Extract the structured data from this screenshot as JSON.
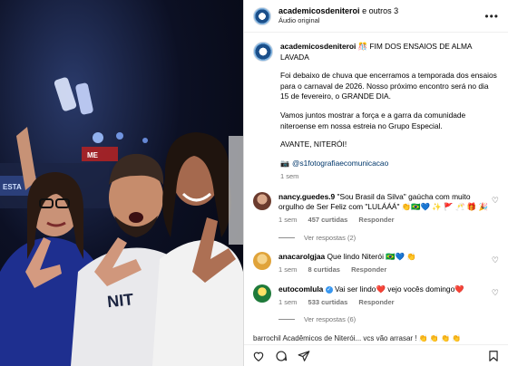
{
  "header": {
    "account": "academicosdeniteroi",
    "and_others": "e outros 3",
    "audio": "Áudio original",
    "more_glyph": "•••"
  },
  "caption": {
    "username": "academicosdeniteroi",
    "emoji": "🎊",
    "headline": "FIM DOS ENSAIOS DE ALMA LAVADA",
    "paragraph1": "Foi debaixo de chuva que encerramos a temporada dos ensaios para o carnaval de 2026. Nosso próximo encontro será no dia 15 de fevereiro, o GRANDE DIA.",
    "paragraph2": "Vamos juntos mostrar a força e a garra da comunidade niteroense em nossa estreia no Grupo Especial.",
    "paragraph3": "AVANTE, NITERÓI!",
    "credit": "@s1fotografiaecomunicacao",
    "time": "1 sem"
  },
  "comments": [
    {
      "username": "nancy.guedes.9",
      "text": "\"Sou Brasil da Silva\" gaúcha com muito orgulho de Ser Feliz com \"LULÁÁÁ\" 👏🇧🇷💙 ✨ 🚩 🥂 🎁 🎉",
      "time": "1 sem",
      "likes": "457 curtidas",
      "reply_label": "Responder",
      "replies": "Ver respostas (2)",
      "avatar_color": "#6b3b2e"
    },
    {
      "username": "anacarolgjaa",
      "text": "Que lindo Niterói 🇧🇷💙 👏",
      "time": "1 sem",
      "likes": "8 curtidas",
      "reply_label": "Responder",
      "replies": "",
      "avatar_color": "#e0a33a"
    },
    {
      "username": "eutocomlula",
      "text": "Vai ser lindo❤️ vejo vocês domingo❤️",
      "time": "1 sem",
      "likes": "533 curtidas",
      "reply_label": "Responder",
      "replies": "Ver respostas (6)",
      "avatar_color": "#1f7a3a"
    }
  ],
  "peek_comment": "barrochil Acadêmicos de Niterói... vcs vão arrasar ! 👏 👏 👏 👏",
  "photo": {
    "shirt_text": "NIT"
  },
  "colors": {
    "link": "#00376b",
    "muted": "#737373",
    "verified": "#3897f0"
  }
}
